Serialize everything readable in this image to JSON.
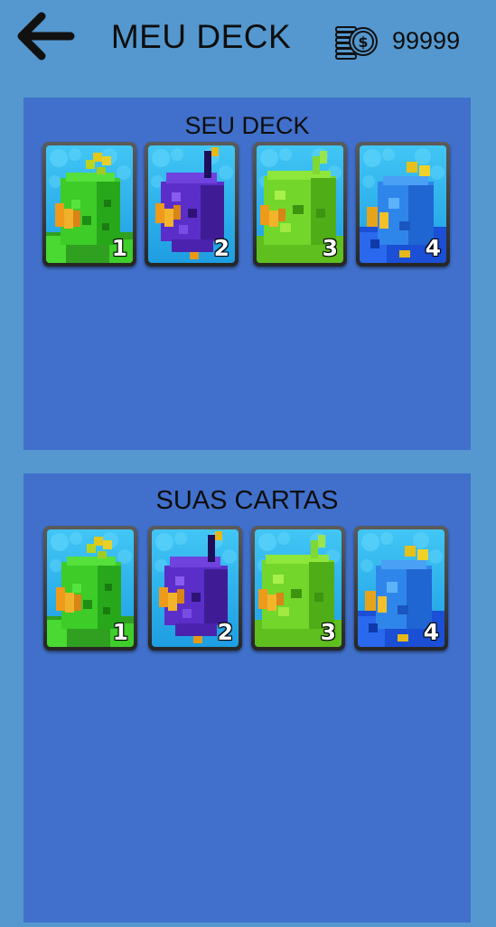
{
  "header": {
    "title": "MEU DECK",
    "coins": "99999",
    "back_icon": "arrow-left-icon",
    "coins_icon": "coin-stack-icon"
  },
  "colors": {
    "background": "#5498cf",
    "panel": "#4070cb",
    "card_sky": "#2ab2ea",
    "green_creature": "#3bd62a",
    "purple_creature": "#5a2bc4",
    "lime_creature": "#7ed32a",
    "blue_creature": "#2a7fe8"
  },
  "deck_panel": {
    "title": "SEU DECK",
    "cards": [
      {
        "level": "1",
        "creature": "green"
      },
      {
        "level": "2",
        "creature": "purple"
      },
      {
        "level": "3",
        "creature": "lime"
      },
      {
        "level": "4",
        "creature": "blue"
      }
    ]
  },
  "collection_panel": {
    "title": "SUAS CARTAS",
    "cards": [
      {
        "level": "1",
        "creature": "green"
      },
      {
        "level": "2",
        "creature": "purple"
      },
      {
        "level": "3",
        "creature": "lime"
      },
      {
        "level": "4",
        "creature": "blue"
      }
    ]
  }
}
